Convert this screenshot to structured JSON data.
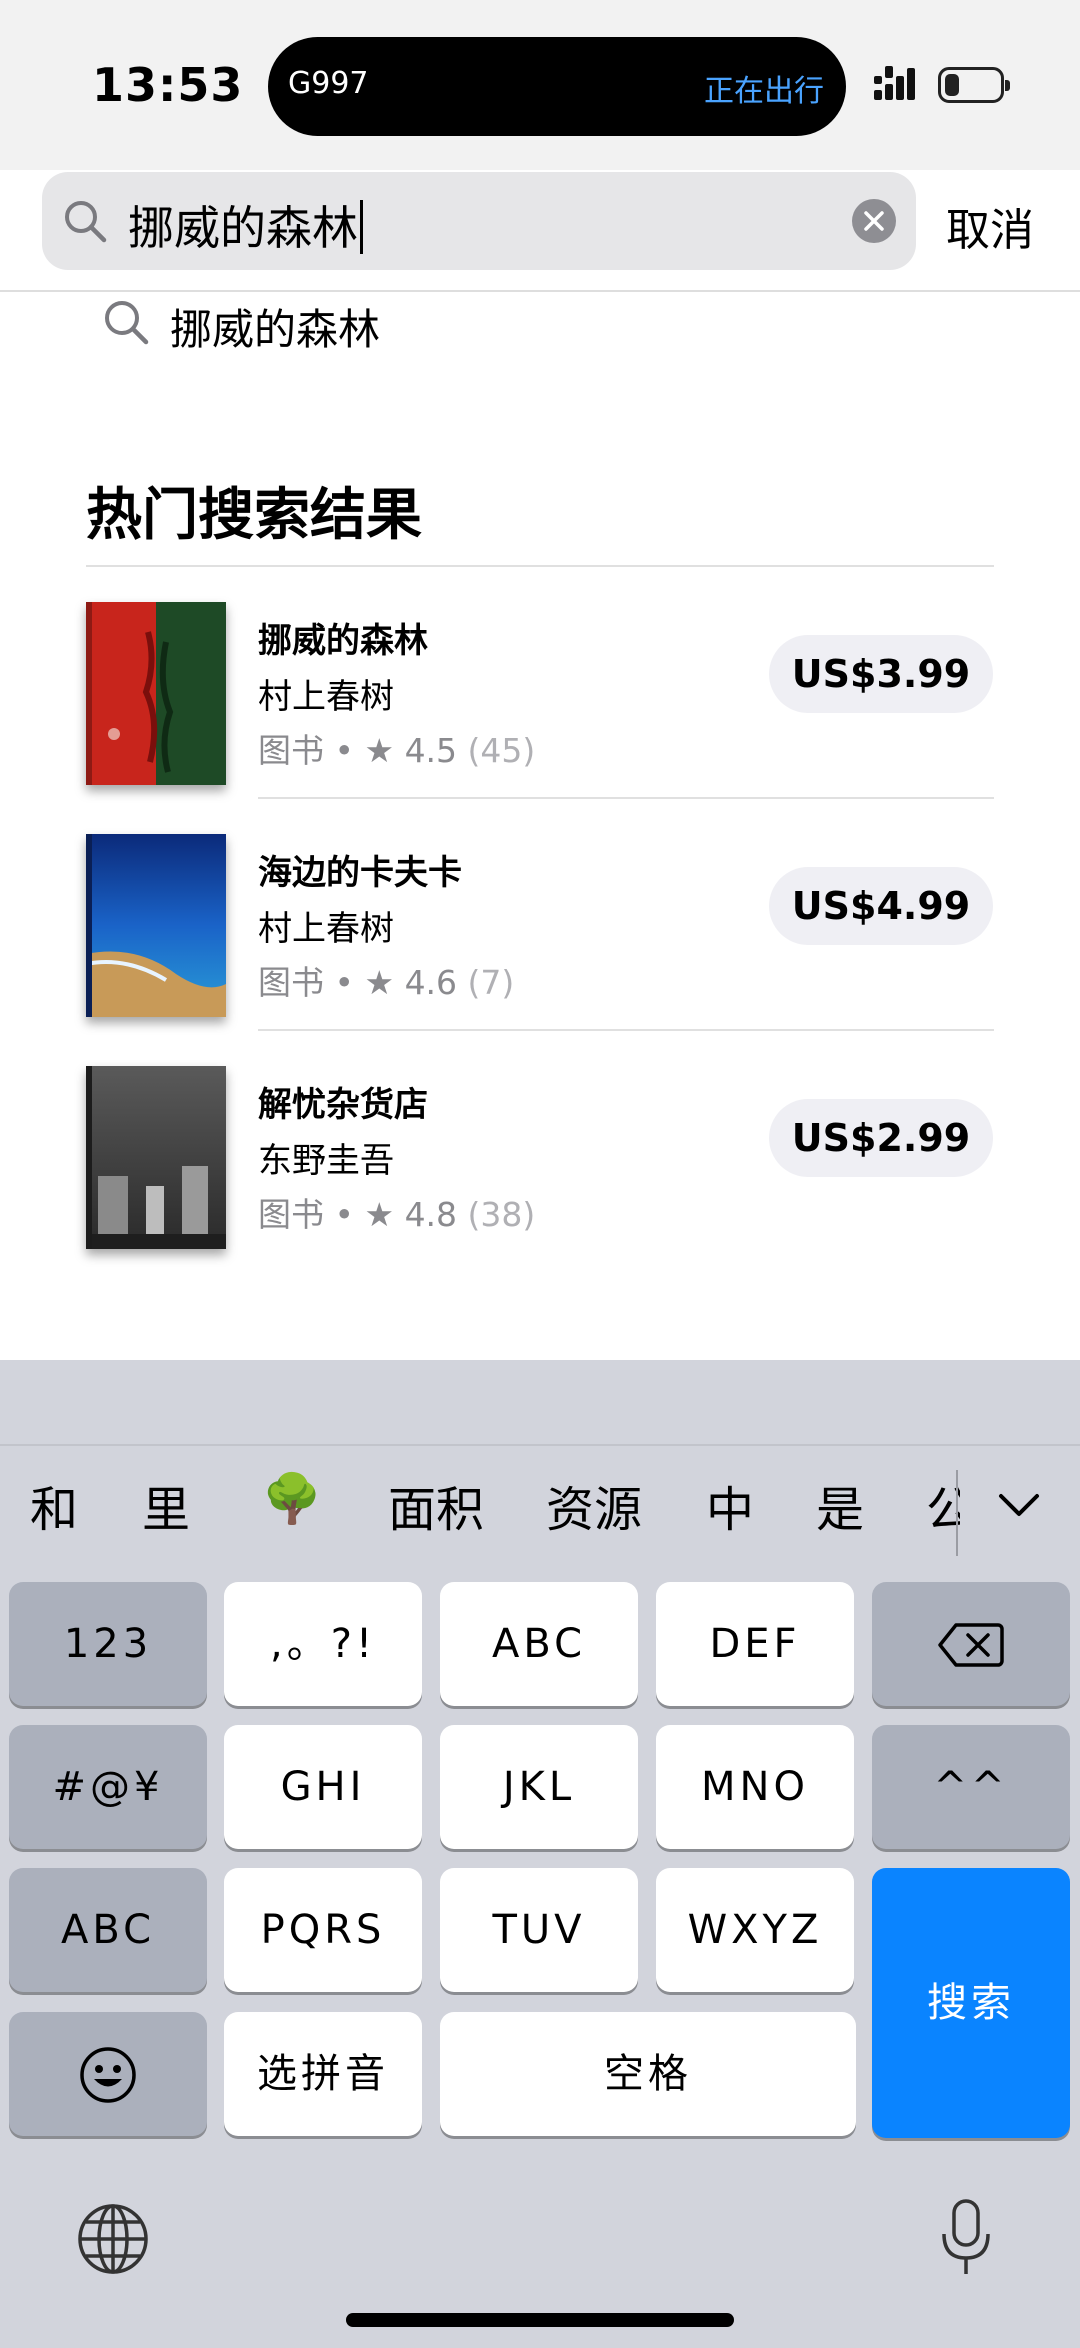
{
  "status_bar": {
    "time": "13:53",
    "island_left": "G997",
    "island_right": "正在出行",
    "island_right_color": "#4aa3ff"
  },
  "search": {
    "query": "挪威的森林",
    "cancel_label": "取消"
  },
  "suggestion": {
    "text": "挪威的森林"
  },
  "results": {
    "section_title": "热门搜索结果",
    "items": [
      {
        "title": "挪威的森林",
        "author": "村上春树",
        "category": "图书",
        "separator": "•",
        "rating": "4.5",
        "rating_count": "(45)",
        "price": "US$3.99",
        "cover_icon": "book-cover-red-green"
      },
      {
        "title": "海边的卡夫卡",
        "author": "村上春树",
        "category": "图书",
        "separator": "•",
        "rating": "4.6",
        "rating_count": "(7)",
        "price": "US$4.99",
        "cover_icon": "book-cover-sea"
      },
      {
        "title": "解忧杂货店",
        "author": "东野圭吾",
        "category": "图书",
        "separator": "•",
        "rating": "4.8",
        "rating_count": "(38)",
        "price": "US$2.99",
        "cover_icon": "book-cover-grey"
      }
    ]
  },
  "keyboard": {
    "candidates": [
      "和",
      "里",
      "🌳",
      "面积",
      "资源",
      "中",
      "是",
      "公"
    ],
    "keys": {
      "num": "123",
      "punct": ",。?!",
      "abc": "ABC",
      "def": "DEF",
      "symbols": "#@¥",
      "ghi": "GHI",
      "jkl": "JKL",
      "mno": "MNO",
      "caret": "^^",
      "abc_mode": "ABC",
      "pqrs": "PQRS",
      "tuv": "TUV",
      "wxyz": "WXYZ",
      "search": "搜索",
      "pinyin": "选拼音",
      "space": "空格"
    },
    "accent_color": "#0a84ff"
  }
}
